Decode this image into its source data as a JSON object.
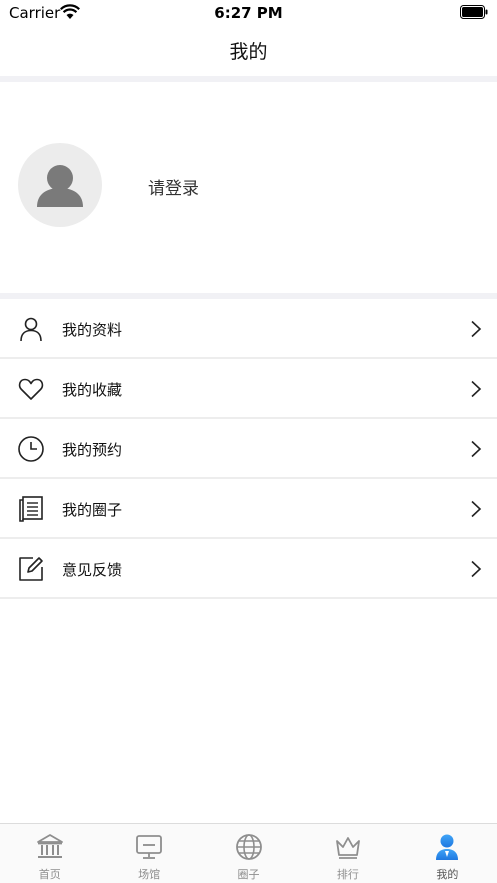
{
  "status_bar": {
    "carrier": "Carrier",
    "time": "6:27 PM"
  },
  "header": {
    "title": "我的"
  },
  "profile": {
    "login_prompt": "请登录"
  },
  "menu": {
    "items": [
      {
        "label": "我的资料",
        "icon": "person-icon"
      },
      {
        "label": "我的收藏",
        "icon": "heart-icon"
      },
      {
        "label": "我的预约",
        "icon": "clock-icon"
      },
      {
        "label": "我的圈子",
        "icon": "notebook-icon"
      },
      {
        "label": "意见反馈",
        "icon": "edit-icon"
      }
    ]
  },
  "tabbar": {
    "tabs": [
      {
        "label": "首页",
        "icon": "bank-icon",
        "active": false
      },
      {
        "label": "场馆",
        "icon": "monitor-icon",
        "active": false
      },
      {
        "label": "圈子",
        "icon": "globe-icon",
        "active": false
      },
      {
        "label": "排行",
        "icon": "crown-icon",
        "active": false
      },
      {
        "label": "我的",
        "icon": "user-icon",
        "active": true
      }
    ]
  },
  "colors": {
    "accent": "#2f8cf0",
    "inactive": "#8e8e8e",
    "separator": "#f1f1f5"
  }
}
